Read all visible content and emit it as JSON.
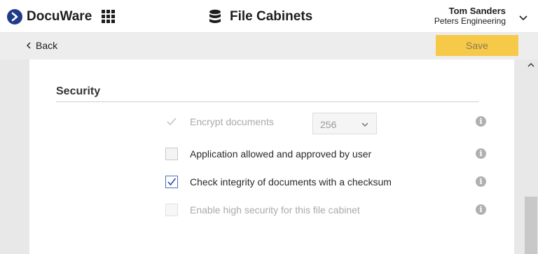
{
  "header": {
    "logo_text": "DocuWare",
    "title": "File Cabinets",
    "user_name": "Tom Sanders",
    "user_org": "Peters Engineering"
  },
  "toolbar": {
    "back_label": "Back",
    "save_label": "Save"
  },
  "section": {
    "title": "Security",
    "settings": [
      {
        "label": "Encrypt documents",
        "checked": true,
        "disabled": true,
        "select_value": "256"
      },
      {
        "label": "Application allowed and approved by user",
        "checked": false,
        "disabled": false
      },
      {
        "label": "Check integrity of documents with a checksum",
        "checked": true,
        "disabled": false
      },
      {
        "label": "Enable high security for this file cabinet",
        "checked": false,
        "disabled": true
      }
    ]
  },
  "colors": {
    "save_button": "#f7c948",
    "logo_blue": "#1f3c88",
    "checkbox_blue": "#4a6fbf"
  },
  "icons": {
    "apps": "apps-grid-icon",
    "database": "database-icon",
    "info": "info-icon",
    "chevron": "chevron-down-icon"
  }
}
